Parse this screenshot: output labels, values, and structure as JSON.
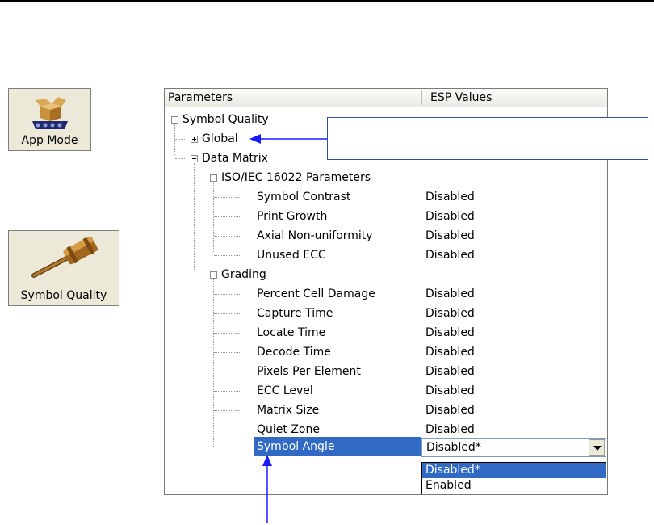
{
  "side_buttons": {
    "app_mode": {
      "label": "App Mode"
    },
    "symbol_quality": {
      "label": "Symbol Quality"
    }
  },
  "table": {
    "headers": {
      "parameters": "Parameters",
      "values": "ESP Values"
    }
  },
  "tree": {
    "root": "Symbol Quality",
    "global": "Global",
    "data_matrix": "Data Matrix",
    "iso_group": "ISO/IEC 16022 Parameters",
    "iso_items": [
      {
        "label": "Symbol Contrast",
        "value": "Disabled"
      },
      {
        "label": "Print Growth",
        "value": "Disabled"
      },
      {
        "label": "Axial Non-uniformity",
        "value": "Disabled"
      },
      {
        "label": "Unused ECC",
        "value": "Disabled"
      }
    ],
    "grading_group": "Grading",
    "grading_items": [
      {
        "label": "Percent Cell Damage",
        "value": "Disabled"
      },
      {
        "label": "Capture Time",
        "value": "Disabled"
      },
      {
        "label": "Locate Time",
        "value": "Disabled"
      },
      {
        "label": "Decode Time",
        "value": "Disabled"
      },
      {
        "label": "Pixels Per Element",
        "value": "Disabled"
      },
      {
        "label": "ECC Level",
        "value": "Disabled"
      },
      {
        "label": "Matrix Size",
        "value": "Disabled"
      },
      {
        "label": "Quiet Zone",
        "value": "Disabled"
      }
    ],
    "selected": {
      "label": "Symbol Angle",
      "value": "Disabled*"
    }
  },
  "dropdown": {
    "options": [
      "Disabled*",
      "Enabled"
    ]
  },
  "colors": {
    "selection": "#316ac5",
    "arrow": "#1a1aff"
  }
}
